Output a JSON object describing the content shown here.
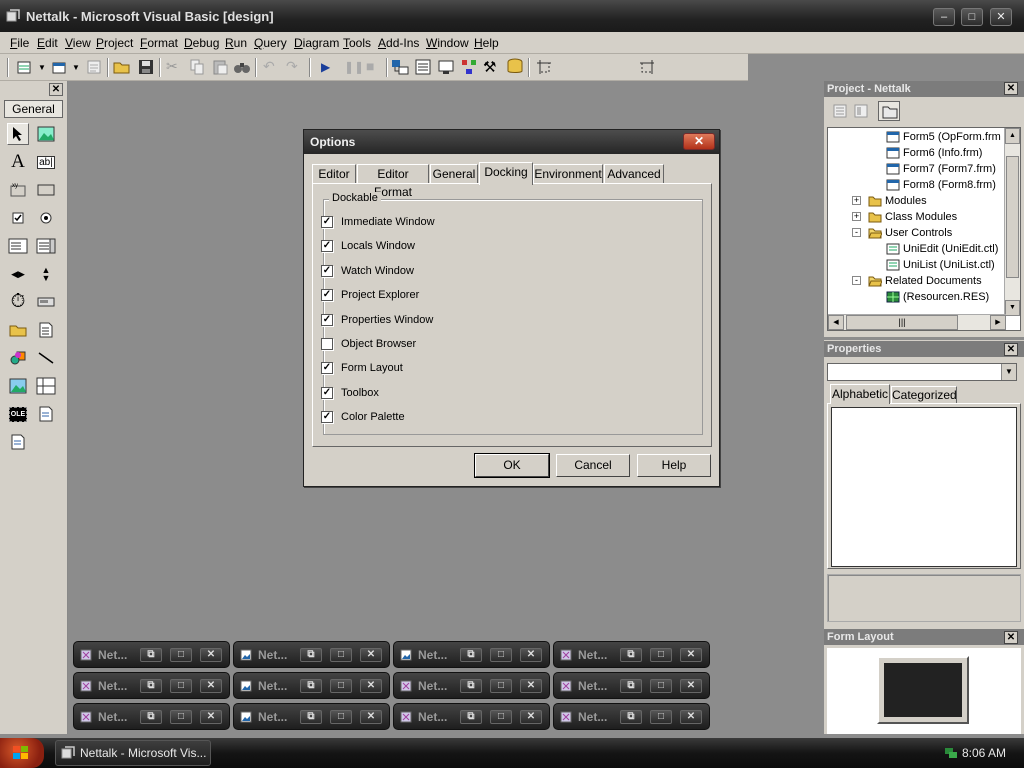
{
  "window": {
    "title": "Nettalk - Microsoft Visual Basic [design]",
    "controls": [
      "minimize",
      "maximize",
      "close"
    ]
  },
  "menu": [
    "File",
    "Edit",
    "View",
    "Project",
    "Format",
    "Debug",
    "Run",
    "Query",
    "Diagram",
    "Tools",
    "Add-Ins",
    "Window",
    "Help"
  ],
  "toolbox": {
    "tab_label": "General",
    "tools": [
      "pointer-icon",
      "picturebox-icon",
      "label-icon",
      "textbox-icon",
      "frame-icon",
      "commandbutton-icon",
      "checkbox-icon",
      "optionbutton-icon",
      "combobox-icon",
      "listbox-icon",
      "hscrollbar-icon",
      "vscrollbar-icon",
      "timer-icon",
      "drivelistbox-icon",
      "dirlistbox-icon",
      "filelistbox-icon",
      "shape-icon",
      "line-icon",
      "image-icon",
      "data-icon",
      "ole-icon",
      "custom-control-icon",
      "custom-control-2-icon"
    ]
  },
  "project_panel": {
    "title": "Project - Nettalk",
    "tree": [
      {
        "label": "Form5 (OpForm.frm",
        "level": 2,
        "icon": "form-icon"
      },
      {
        "label": "Form6 (Info.frm)",
        "level": 2,
        "icon": "form-icon"
      },
      {
        "label": "Form7 (Form7.frm)",
        "level": 2,
        "icon": "form-icon"
      },
      {
        "label": "Form8 (Form8.frm)",
        "level": 2,
        "icon": "form-icon"
      },
      {
        "label": "Modules",
        "level": 1,
        "icon": "folder-icon",
        "expander": "+"
      },
      {
        "label": "Class Modules",
        "level": 1,
        "icon": "folder-icon",
        "expander": "+"
      },
      {
        "label": "User Controls",
        "level": 1,
        "icon": "folder-open-icon",
        "expander": "-"
      },
      {
        "label": "UniEdit (UniEdit.ctl)",
        "level": 2,
        "icon": "usercontrol-icon"
      },
      {
        "label": "UniList (UniList.ctl)",
        "level": 2,
        "icon": "usercontrol-icon"
      },
      {
        "label": "Related Documents",
        "level": 1,
        "icon": "folder-open-icon",
        "expander": "-"
      },
      {
        "label": "(Resourcen.RES)",
        "level": 2,
        "icon": "resource-icon"
      }
    ]
  },
  "properties_panel": {
    "title": "Properties",
    "object_select": "",
    "tabs": [
      "Alphabetic",
      "Categorized"
    ],
    "active_tab": "Alphabetic"
  },
  "form_layout_panel": {
    "title": "Form Layout"
  },
  "dialog": {
    "title": "Options",
    "tabs": [
      "Editor",
      "Editor Format",
      "General",
      "Docking",
      "Environment",
      "Advanced"
    ],
    "active_tab": "Docking",
    "group_label": "Dockable",
    "checkboxes": [
      {
        "label": "Immediate Window",
        "checked": true
      },
      {
        "label": "Locals Window",
        "checked": true
      },
      {
        "label": "Watch Window",
        "checked": true
      },
      {
        "label": "Project Explorer",
        "checked": true
      },
      {
        "label": "Properties Window",
        "checked": true
      },
      {
        "label": "Object Browser",
        "checked": false
      },
      {
        "label": "Form Layout",
        "checked": true
      },
      {
        "label": "Toolbox",
        "checked": true
      },
      {
        "label": "Color Palette",
        "checked": true
      }
    ],
    "buttons": {
      "ok": "OK",
      "cancel": "Cancel",
      "help": "Help"
    }
  },
  "minimized_windows": {
    "label": "Net...",
    "rows": [
      [
        "form-icon",
        "image-icon",
        "image-icon",
        "form-icon"
      ],
      [
        "form-icon",
        "image-icon",
        "form-icon",
        "form-icon"
      ],
      [
        "form-icon",
        "image-icon",
        "form-icon",
        "form-icon"
      ]
    ]
  },
  "taskbar": {
    "task": "Nettalk - Microsoft Vis...",
    "clock": "8:06 AM"
  },
  "colors": {
    "face": "#d4d0c8",
    "workspace": "#8c8c8c",
    "titlebar": "#262626",
    "close_red": "#c0392b"
  }
}
